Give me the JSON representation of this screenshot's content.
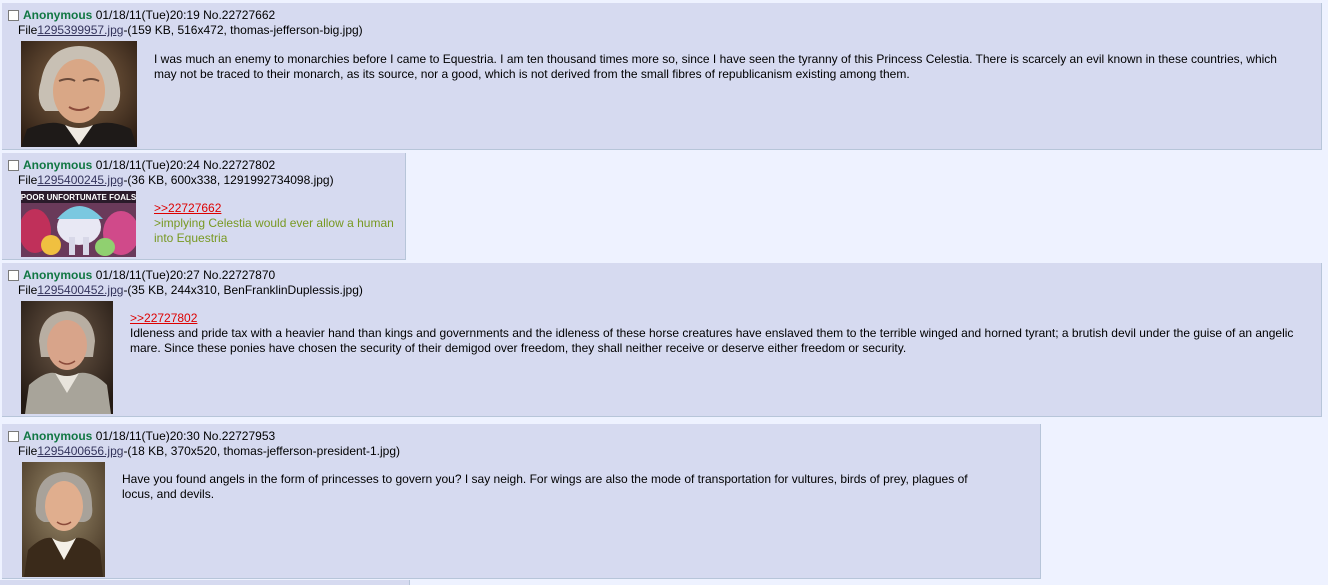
{
  "posts": [
    {
      "name": "Anonymous",
      "datetime": "01/18/11(Tue)20:19",
      "no": "No.22727662",
      "file_prefix": "File",
      "file_link": "1295399957.jpg",
      "file_meta": "-(159 KB, 516x472, thomas-jefferson-big.jpg)",
      "quote_link": "",
      "greentext": "",
      "message": "I was much an enemy to monarchies before I came to Equestria. I am ten thousand times more so, since I have seen the tyranny of this Princess Celestia. There is scarcely an evil known in these countries, which may not be traced to their monarch, as its source, nor a good, which is not derived from the small fibres of republicanism existing among them."
    },
    {
      "name": "Anonymous",
      "datetime": "01/18/11(Tue)20:24",
      "no": "No.22727802",
      "file_prefix": "File",
      "file_link": "1295400245.jpg",
      "file_meta": "-(36 KB, 600x338, 1291992734098.jpg)",
      "thumb_caption": "POOR UNFORTUNATE FOALS",
      "quote_link": ">>22727662",
      "greentext": ">implying Celestia would ever allow a human into Equestria",
      "message": ""
    },
    {
      "name": "Anonymous",
      "datetime": "01/18/11(Tue)20:27",
      "no": "No.22727870",
      "file_prefix": "File",
      "file_link": "1295400452.jpg",
      "file_meta": "-(35 KB, 244x310, BenFranklinDuplessis.jpg)",
      "quote_link": ">>22727802",
      "greentext": "",
      "message": "Idleness and pride tax with a heavier hand than kings and governments and the idleness of these horse creatures have enslaved them to the terrible winged and horned tyrant; a brutish devil under the guise of an angelic mare. Since these ponies have chosen the security of their demigod over freedom, they shall neither receive or deserve either freedom or security."
    },
    {
      "name": "Anonymous",
      "datetime": "01/18/11(Tue)20:30",
      "no": "No.22727953",
      "file_prefix": "File",
      "file_link": "1295400656.jpg",
      "file_meta": "-(18 KB, 370x520, thomas-jefferson-president-1.jpg)",
      "quote_link": "",
      "greentext": "",
      "message": "Have you found angels in the form of princesses to govern you? I say neigh. For wings are also the mode of transportation for vultures, birds of prey, plagues of locus, and devils."
    }
  ],
  "colors": {
    "reply_bg": "#d6daf0",
    "page_bg": "#eef2ff",
    "name": "#117743",
    "quote_link": "#dd0000",
    "greentext": "#789922",
    "file_link": "#34345c"
  }
}
